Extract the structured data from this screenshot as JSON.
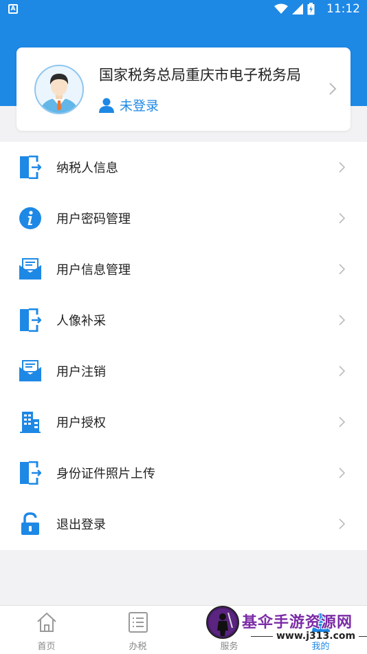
{
  "status_bar": {
    "notification": "A",
    "time": "11:12"
  },
  "profile": {
    "org_name": "国家税务总局重庆市电子税务局",
    "login_status": "未登录"
  },
  "menu": [
    {
      "label": "纳税人信息",
      "icon": "door-exit-icon"
    },
    {
      "label": "用户密码管理",
      "icon": "info-icon"
    },
    {
      "label": "用户信息管理",
      "icon": "mail-icon"
    },
    {
      "label": "人像补采",
      "icon": "door-exit-icon"
    },
    {
      "label": "用户注销",
      "icon": "mail-icon"
    },
    {
      "label": "用户授权",
      "icon": "building-icon"
    },
    {
      "label": "身份证件照片上传",
      "icon": "door-exit-icon"
    },
    {
      "label": "退出登录",
      "icon": "lock-icon"
    }
  ],
  "tabs": [
    {
      "label": "首页",
      "icon": "home-icon"
    },
    {
      "label": "办税",
      "icon": "list-icon"
    },
    {
      "label": "服务",
      "icon": "service-icon"
    },
    {
      "label": "我的",
      "icon": "user-icon",
      "active": true
    }
  ],
  "watermark": {
    "title": "基伞手游资源网",
    "url": "www.j313.com"
  },
  "colors": {
    "primary": "#1e88e5",
    "background": "#f2f2f4",
    "text": "#222222"
  }
}
